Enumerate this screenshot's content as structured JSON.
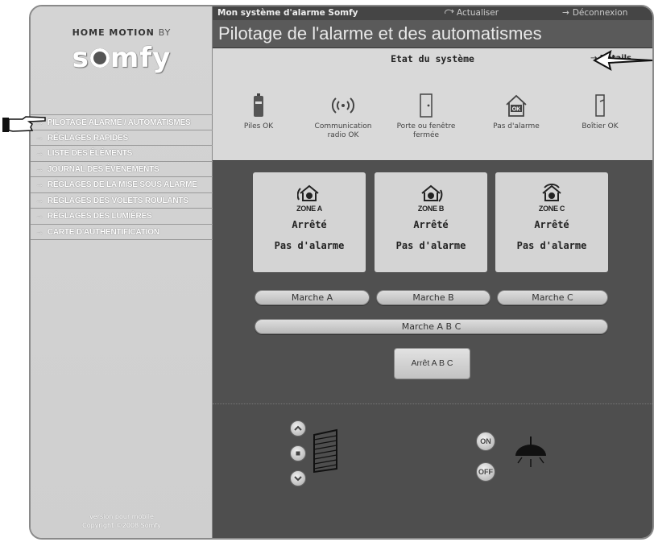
{
  "brand": {
    "name": "HOME MOTION",
    "by": "BY",
    "logo": "somfy"
  },
  "menu": [
    "PILOTAGE ALARME / AUTOMATISMES",
    "RÉGLAGES RAPIDES",
    "LISTE DES ÉLÉMENTS",
    "JOURNAL DES ÉVÉNEMENTS",
    "RÉGLAGES DE LA MISE SOUS ALARME",
    "RÉGLAGES DES VOLETS ROULANTS",
    "RÉGLAGES DES LUMIÈRES",
    "CARTE D'AUTHENTIFICATION"
  ],
  "version": {
    "line1": "version pour mobile",
    "line2": "Copyright ©2008 Somfy"
  },
  "topbar": {
    "title": "Mon système d'alarme Somfy",
    "refresh": "Actualiser",
    "logout": "Déconnexion"
  },
  "page_title": "Pilotage de l'alarme et des automatismes",
  "status": {
    "heading": "Etat du système",
    "details": "Détails",
    "items": [
      {
        "icon": "battery-icon",
        "label": "Piles OK",
        "label2": ""
      },
      {
        "icon": "radio-signal-icon",
        "label": "Communication",
        "label2": "radio OK"
      },
      {
        "icon": "door-icon",
        "label": "Porte ou fenêtre",
        "label2": "fermée"
      },
      {
        "icon": "house-ok-icon",
        "label": "Pas d'alarme",
        "label2": ""
      },
      {
        "icon": "control-box-icon",
        "label": "Boîtier OK",
        "label2": ""
      }
    ]
  },
  "zones": [
    {
      "name": "ZONE A",
      "state": "Arrêté",
      "alarm": "Pas d'alarme"
    },
    {
      "name": "ZONE B",
      "state": "Arrêté",
      "alarm": "Pas d'alarme"
    },
    {
      "name": "ZONE C",
      "state": "Arrêté",
      "alarm": "Pas d'alarme"
    }
  ],
  "buttons": {
    "marche_a": "Marche A",
    "marche_b": "Marche B",
    "marche_c": "Marche C",
    "marche_abc": "Marche A B C",
    "arret_abc": "Arrêt A B C",
    "light_on": "ON",
    "light_off": "OFF"
  }
}
